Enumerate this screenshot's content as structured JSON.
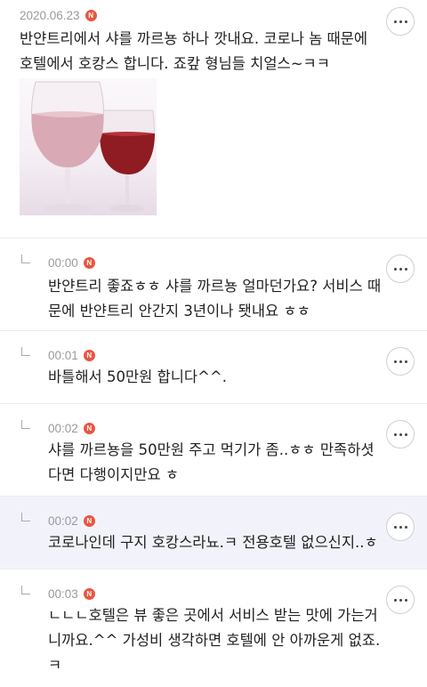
{
  "post": {
    "date": "2020.06.23",
    "badge": "N",
    "text": "반얀트리에서 샤를 까르뇽 하나 깟내요. 코로나 놈 때문에\n호텔에서 호캉스 합니다. 죠캎 형님들 치얼스~ㅋㅋ",
    "image_icon": "wine-glasses-photo"
  },
  "replies": [
    {
      "time": "00:00",
      "badge": "N",
      "text": "반얀트리 좋죠ㅎㅎ 샤를 까르뇽 얼마던가요? 서비스 때\n문에 반얀트리 안간지 3년이나 됏내요 ㅎㅎ"
    },
    {
      "time": "00:01",
      "badge": "N",
      "text": "바틀해서 50만원 합니다^^."
    },
    {
      "time": "00:02",
      "badge": "N",
      "text": "샤를 까르뇽을 50만원 주고 먹기가 좀..ㅎㅎ 만족하셧\n다면 다행이지만요 ㅎ"
    },
    {
      "time": "00:02",
      "badge": "N",
      "text": "코로나인데 구지 호캉스라뇨.ㅋ 전용호텔 없으신지..ㅎ"
    },
    {
      "time": "00:03",
      "badge": "N",
      "text": "ㄴㄴㄴ호텔은 뷰 좋은 곳에서 서비스 받는 맛에 가는거\n니까요.^^ 가성비 생각하면 호텔에 안 아까운게 없죠.\nㅋ"
    }
  ],
  "icons": {
    "more": "more-options-icon",
    "reply": "reply-arrow-icon",
    "new": "new-badge-icon"
  },
  "colors": {
    "badge": "#e8563f",
    "highlight_bg": "#f2f3fa",
    "meta_text": "#9a9a9a"
  }
}
